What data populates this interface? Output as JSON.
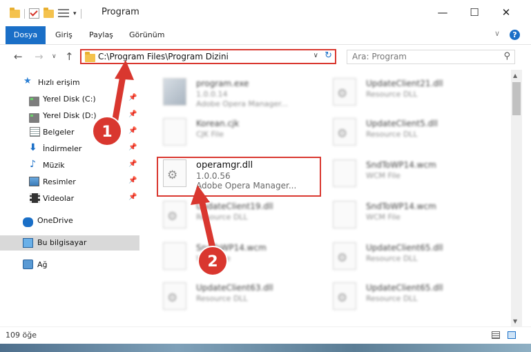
{
  "window": {
    "title": "Program",
    "buttons": {
      "minimize": "—",
      "maximize": "☐",
      "close": "✕"
    }
  },
  "ribbon": {
    "tabs": [
      "Dosya",
      "Giriş",
      "Paylaş",
      "Görünüm"
    ]
  },
  "address": {
    "path": "C:\\Program Files\\Program Dizini",
    "search_placeholder": "Ara: Program"
  },
  "nav": {
    "quick_access": "Hızlı erişim",
    "items": [
      {
        "label": "Yerel Disk (C:)",
        "icon": "drive-icon"
      },
      {
        "label": "Yerel Disk (D:)",
        "icon": "drive-icon"
      },
      {
        "label": "Belgeler",
        "icon": "documents-icon"
      },
      {
        "label": "İndirmeler",
        "icon": "downloads-icon"
      },
      {
        "label": "Müzik",
        "icon": "music-icon"
      },
      {
        "label": "Resimler",
        "icon": "pictures-icon"
      },
      {
        "label": "Videolar",
        "icon": "videos-icon"
      }
    ],
    "onedrive": "OneDrive",
    "this_pc": "Bu bilgisayar",
    "network": "Ağ"
  },
  "files": {
    "left": [
      {
        "name": "program.exe",
        "line2": "1.0.0.14",
        "line3": "Adobe Opera Manager..."
      },
      {
        "name": "Korean.cjk",
        "line2": "CJK File",
        "line3": ""
      },
      {
        "name": "operamgr.dll",
        "line2": "1.0.0.56",
        "line3": "Adobe Opera Manager..."
      },
      {
        "name": "UpdateClient19.dll",
        "line2": "Resource DLL",
        "line3": ""
      },
      {
        "name": "SndToWP14.wcm",
        "line2": "WCM File",
        "line3": ""
      },
      {
        "name": "UpdateClient63.dll",
        "line2": "Resource DLL",
        "line3": ""
      }
    ],
    "right": [
      {
        "name": "UpdateClient21.dll",
        "line2": "Resource DLL"
      },
      {
        "name": "UpdateClient5.dll",
        "line2": "Resource DLL"
      },
      {
        "name": "SndToWP14.wcm",
        "line2": "WCM File"
      },
      {
        "name": "SndToWP14.wcm",
        "line2": "WCM File"
      },
      {
        "name": "UpdateClient65.dll",
        "line2": "Resource DLL"
      },
      {
        "name": "UpdateClient65.dll",
        "line2": "Resource DLL"
      }
    ]
  },
  "status": {
    "count": "109 öğe"
  },
  "annotations": {
    "step1": "1",
    "step2": "2",
    "color": "#d9372f"
  }
}
